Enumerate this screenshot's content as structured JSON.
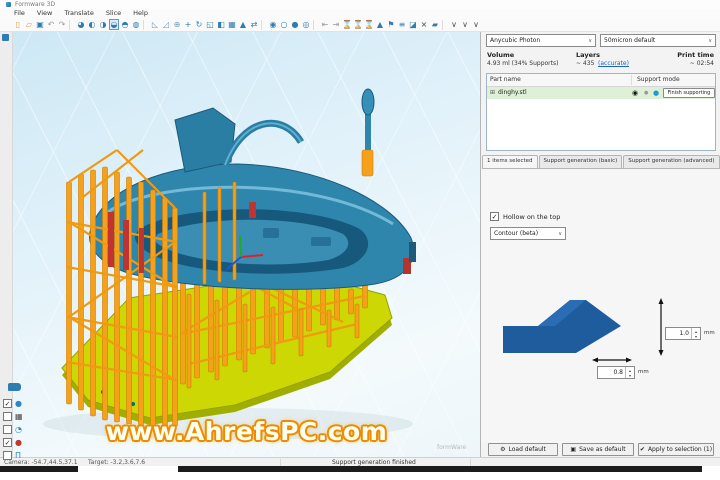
{
  "window": {
    "title": "Formware 3D"
  },
  "menu": {
    "items": [
      "File",
      "View",
      "Translate",
      "Slice",
      "Help"
    ]
  },
  "toolbar": {
    "icons": [
      {
        "name": "new-file-icon",
        "glyph": "▯",
        "color": "#d7a33b"
      },
      {
        "name": "open-file-icon",
        "glyph": "▱",
        "color": "#d7a33b"
      },
      {
        "name": "save-icon",
        "glyph": "▣",
        "color": "#2e7db2"
      },
      {
        "name": "undo-icon",
        "glyph": "↶",
        "color": "#9a9a9a"
      },
      {
        "name": "redo-icon",
        "glyph": "↷",
        "color": "#9a9a9a"
      },
      {
        "sep": true
      },
      {
        "name": "view-orbit-icon",
        "glyph": "◕",
        "color": "#2e7db2"
      },
      {
        "name": "view-front-icon",
        "glyph": "◐",
        "color": "#2e7db2"
      },
      {
        "name": "view-back-icon",
        "glyph": "◑",
        "color": "#2e7db2"
      },
      {
        "name": "view-left-icon",
        "glyph": "◒",
        "color": "#2e7db2",
        "active": true
      },
      {
        "name": "view-right-icon",
        "glyph": "◓",
        "color": "#2e7db2"
      },
      {
        "name": "view-top-icon",
        "glyph": "◍",
        "color": "#2e7db2"
      },
      {
        "sep": true
      },
      {
        "name": "drop-to-plate-icon",
        "glyph": "◺",
        "color": "#6f9cc0"
      },
      {
        "name": "lay-flat-icon",
        "glyph": "◿",
        "color": "#6f9cc0"
      },
      {
        "name": "center-model-icon",
        "glyph": "⊕",
        "color": "#6f9cc0"
      },
      {
        "name": "move-icon",
        "glyph": "+",
        "color": "#2e7db2"
      },
      {
        "name": "rotate-icon",
        "glyph": "↻",
        "color": "#2e7db2"
      },
      {
        "name": "scale-icon",
        "glyph": "◱",
        "color": "#2e7db2"
      },
      {
        "name": "mirror-icon",
        "glyph": "◧",
        "color": "#2e7db2"
      },
      {
        "name": "array-icon",
        "glyph": "▦",
        "color": "#2e7db2"
      },
      {
        "name": "text-tool-icon",
        "glyph": "▲",
        "color": "#2e7db2"
      },
      {
        "name": "measure-icon",
        "glyph": "⇄",
        "color": "#2e7db2"
      },
      {
        "sep": true
      },
      {
        "name": "shaded-view-icon",
        "glyph": "◉",
        "color": "#2e7db2"
      },
      {
        "name": "wireframe-view-icon",
        "glyph": "○",
        "color": "#2e7db2"
      },
      {
        "name": "solid-view-icon",
        "glyph": "●",
        "color": "#2e7db2"
      },
      {
        "name": "xray-view-icon",
        "glyph": "◎",
        "color": "#2e7db2"
      },
      {
        "sep": true
      },
      {
        "name": "clip-start-icon",
        "glyph": "⇤",
        "color": "#9a9a9a"
      },
      {
        "name": "clip-end-icon",
        "glyph": "⇥",
        "color": "#9a9a9a"
      },
      {
        "name": "hollow-tool-icon",
        "glyph": "⌛",
        "color": "#2e7db2"
      },
      {
        "name": "infill-tool-icon",
        "glyph": "⌛",
        "color": "#6f9cc0"
      },
      {
        "name": "drain-hole-icon",
        "glyph": "⌛",
        "color": "#2e7db2"
      },
      {
        "name": "island-detect-icon",
        "glyph": "▲",
        "color": "#2e7db2"
      },
      {
        "name": "flag-icon",
        "glyph": "⚑",
        "color": "#2e7db2"
      },
      {
        "name": "slice-preview-icon",
        "glyph": "≡",
        "color": "#2e7db2"
      },
      {
        "name": "mask-icon",
        "glyph": "◪",
        "color": "#2e7db2"
      },
      {
        "name": "cut-icon",
        "glyph": "×",
        "color": "#444444"
      },
      {
        "name": "export-icon",
        "glyph": "▰",
        "color": "#2e7db2"
      },
      {
        "sep": true
      },
      {
        "name": "more-dropdown-1-icon",
        "glyph": "∨",
        "color": "#555555"
      },
      {
        "name": "more-dropdown-2-icon",
        "glyph": "∨",
        "color": "#555555"
      },
      {
        "name": "more-dropdown-3-icon",
        "glyph": "∨",
        "color": "#555555"
      }
    ]
  },
  "viewport": {
    "watermark": "www.AhrefsPC.com",
    "brand": "formWare",
    "toggles": [
      {
        "name": "show-supports",
        "glyph": "●",
        "color": "#2e86c8",
        "checked": true
      },
      {
        "name": "show-grid",
        "glyph": "▦",
        "color": "#4a4a4a",
        "checked": false
      },
      {
        "name": "show-model",
        "glyph": "◔",
        "color": "#2e86c8",
        "checked": false
      },
      {
        "name": "show-overhangs",
        "glyph": "●",
        "color": "#c0392b",
        "checked": true
      },
      {
        "name": "show-platform",
        "glyph": "Π",
        "color": "#2e86c8",
        "checked": false
      }
    ]
  },
  "panel": {
    "printer": "Anycubic Photon",
    "profile": "50micron default",
    "stats": {
      "volume_label": "Volume",
      "volume_value": "4.93 ml (34% Supports)",
      "layers_label": "Layers",
      "layers_value": "~ 435",
      "layers_link": "(accurate)",
      "time_label": "Print time",
      "time_value": "~ 02:54"
    },
    "table": {
      "col_part": "Part name",
      "col_support": "Support mode",
      "row": {
        "expand": "⊞",
        "name": "dinghy.stl",
        "action": "Finish supporting"
      }
    },
    "tabs": [
      {
        "label": "1 items selected",
        "active": true
      },
      {
        "label": "Support generation (basic)",
        "active": false
      },
      {
        "label": "Support generation (advanced)",
        "active": false
      }
    ],
    "hollow_label": "Hollow on the top",
    "hollow_checked": true,
    "contour": "Contour (beta)",
    "diagram": {
      "height_value": "1.0",
      "height_unit": "mm",
      "width_value": "0.8",
      "width_unit": "mm"
    },
    "buttons": [
      {
        "name": "load-default-button",
        "glyph": "⚙",
        "label": "Load default"
      },
      {
        "name": "save-as-default-button",
        "glyph": "▣",
        "label": "Save as default"
      },
      {
        "name": "apply-to-selection-button",
        "glyph": "✔",
        "label": "Apply to selection (1)"
      }
    ]
  },
  "statusbar": {
    "camera": "Camera:  -54.7,44.5,37.1",
    "target": "Target:  -3.2,3.6,7.6",
    "message": "Support generation finished"
  },
  "ui": {
    "chevron_down": "∨",
    "check": "✓",
    "spin_up": "▴",
    "spin_down": "▾",
    "eye": "◉",
    "lock": "●",
    "dot": "●"
  },
  "colors": {
    "accent": "#2e7db2",
    "hull": "#2f86ad",
    "support": "#f5a11c",
    "base_plate": "#c9d400",
    "row_highlight": "#def0d6",
    "support_dot": "#1a9cd8"
  }
}
